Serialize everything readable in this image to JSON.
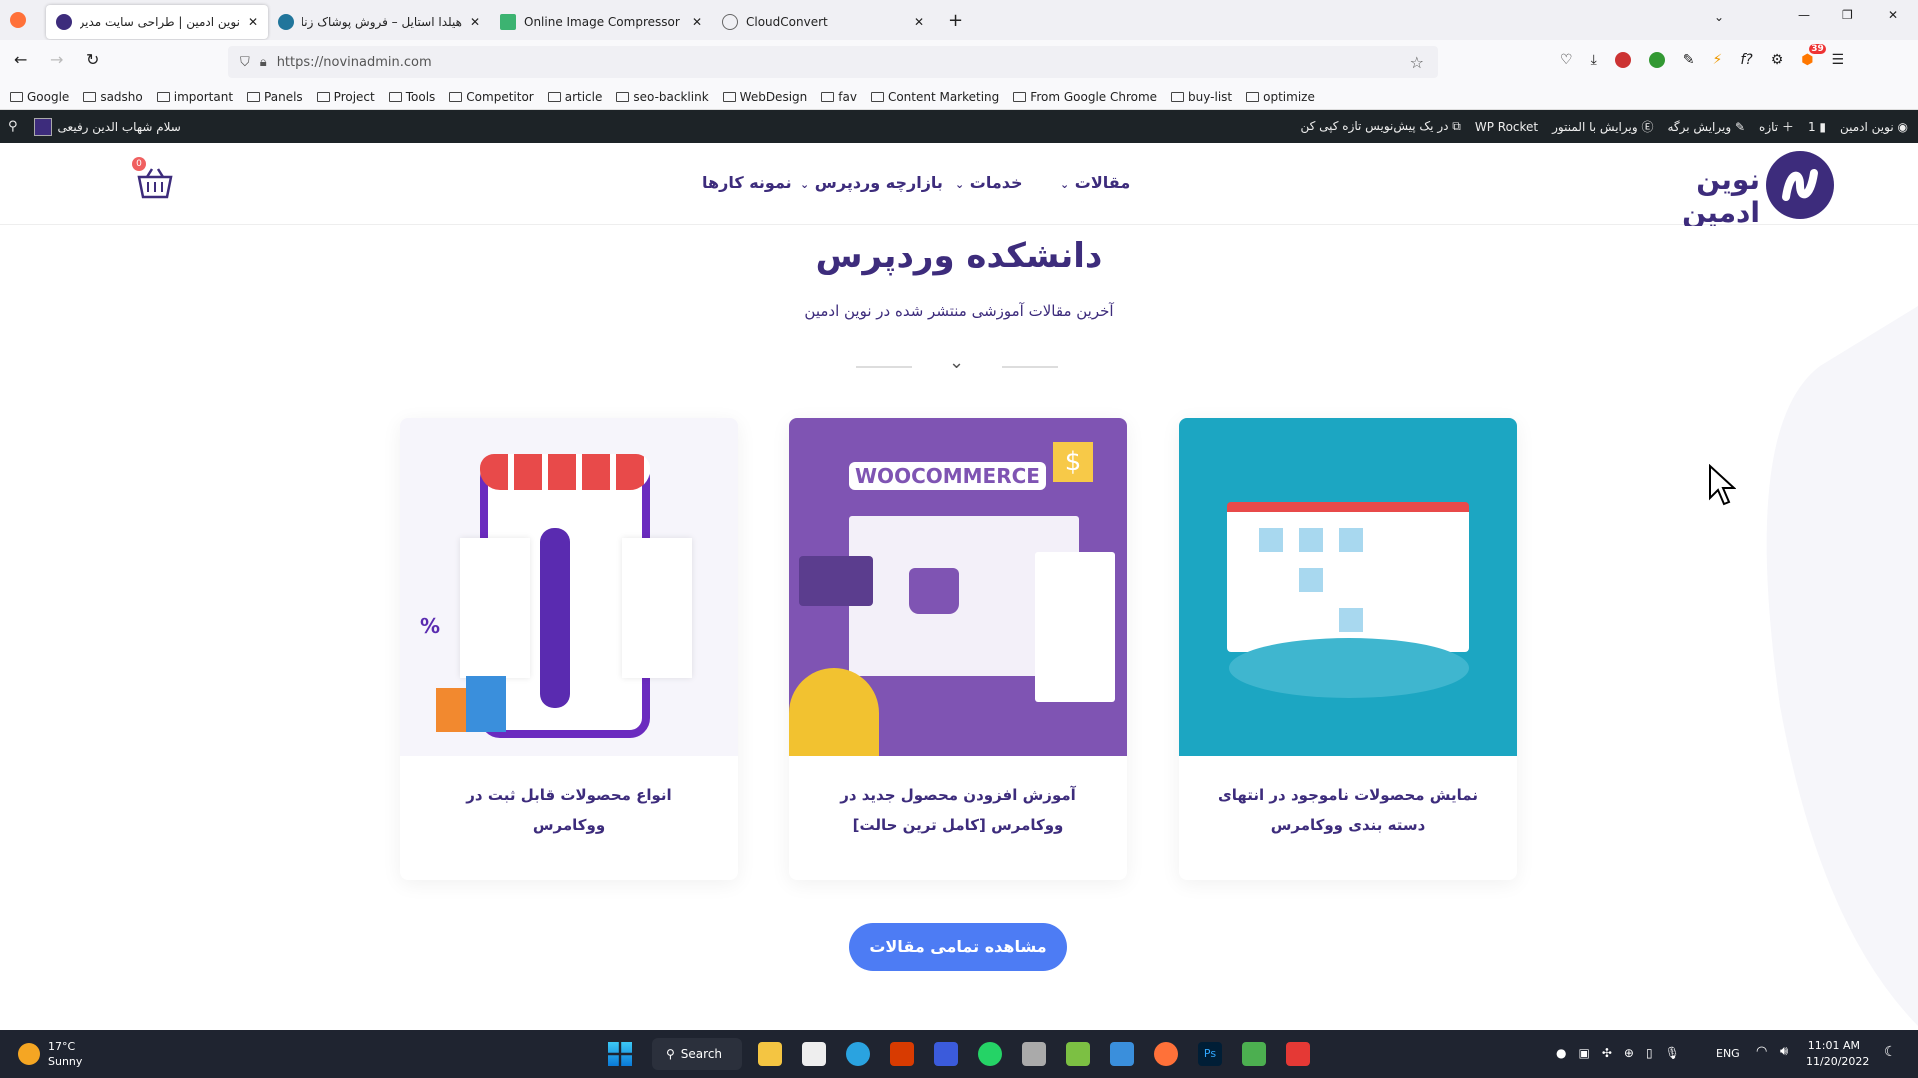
{
  "browser": {
    "tabs": [
      {
        "title": "نوین ادمین | طراحی سایت مدیر",
        "active": true,
        "icon": "novinadmin-icon"
      },
      {
        "title": "هیلدا استایل – فروش پوشاک زنانه",
        "active": false,
        "icon": "wordpress-icon"
      },
      {
        "title": "Online Image Compressor",
        "active": false,
        "icon": "compressor-icon"
      },
      {
        "title": "CloudConvert",
        "active": false,
        "icon": "cloudconvert-icon"
      }
    ],
    "url": "https://novinadmin.com",
    "bookmarks": [
      "Google",
      "sadsho",
      "important",
      "Panels",
      "Project",
      "Tools",
      "Competitor",
      "article",
      "seo-backlink",
      "WebDesign",
      "fav",
      "Content Marketing",
      "From Google Chrome",
      "buy-list",
      "optimize"
    ],
    "extension_badge": "39"
  },
  "adminbar": {
    "greeting": "سلام شهاب الدین رفیعی",
    "site": "نوین ادمین",
    "comments": "1",
    "new": "تازه",
    "edit_page": "ویرایش برگه",
    "edit_elementor": "ویرایش با المنتور",
    "wp_rocket": "WP Rocket",
    "draft": "در یک پیش‌نویس تازه کپی کن"
  },
  "header": {
    "logo_text": "نوین ادمین",
    "menu": [
      "مقالات",
      "خدمات",
      "بازارچه وردپرس",
      "نمونه کارها"
    ],
    "cart_count": "0",
    "brand_color": "#3d2c7c"
  },
  "section": {
    "title": "دانشکده وردپرس",
    "subtitle": "آخرین مقالات آموزشی منتشر شده در نوین ادمین",
    "cards": [
      {
        "title": "نمایش محصولات ناموجود در انتهای دسته بندی ووکامرس",
        "bg": "#1ca6c2"
      },
      {
        "title": "آموزش افزودن محصول جدید در ووکامرس [کامل ترین حالت]",
        "bg": "#7f54b3",
        "img_text": "WOOCOMMERCE"
      },
      {
        "title": "انواع محصولات قابل ثبت در ووکامرس",
        "bg": "#f6f5fb"
      }
    ],
    "button": "مشاهده تمامی مقالات",
    "button_color": "#4d7cf4"
  },
  "taskbar": {
    "weather_temp": "17°C",
    "weather_desc": "Sunny",
    "search": "Search",
    "lang": "ENG",
    "time": "11:01 AM",
    "date": "11/20/2022"
  }
}
